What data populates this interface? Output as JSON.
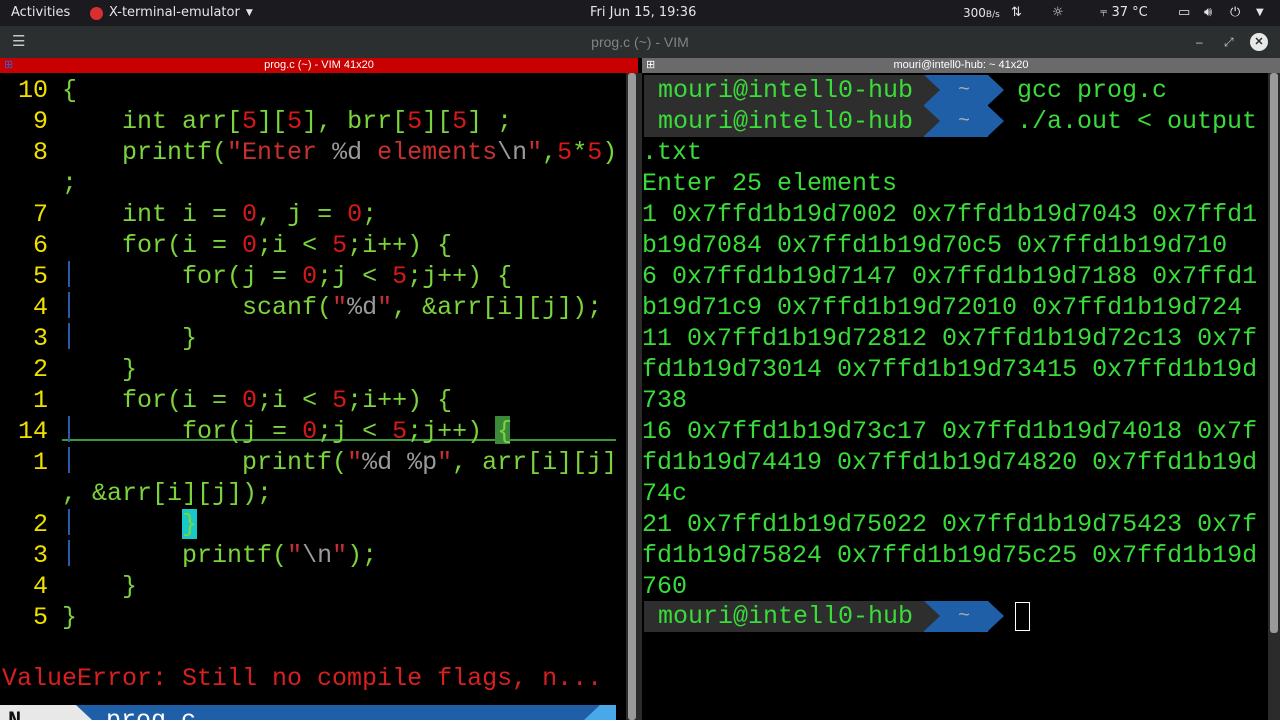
{
  "topbar": {
    "activities": "Activities",
    "app_menu": "X-terminal-emulator",
    "clock": "Fri Jun 15, 19:36",
    "net_speed": "300",
    "net_unit": "B/s",
    "temperature": "37 °C"
  },
  "window": {
    "title": "prog.c (~) - VIM"
  },
  "panes": {
    "left_title": "prog.c (~) - VIM 41x20",
    "right_title": "mouri@intell0-hub: ~ 41x20"
  },
  "vim": {
    "lines": [
      {
        "ln": "10",
        "code": "{"
      },
      {
        "ln": "9",
        "code": "    int arr[5][5], brr[5][5] ;"
      },
      {
        "ln": "8",
        "code": "    printf(\"Enter %d elements\\n\",5*5)"
      },
      {
        "ln": "",
        "code": ";"
      },
      {
        "ln": "7",
        "code": "    int i = 0, j = 0;"
      },
      {
        "ln": "6",
        "code": "    for(i = 0;i < 5;i++) {"
      },
      {
        "ln": "5",
        "code": "        for(j = 0;j < 5;j++) {"
      },
      {
        "ln": "4",
        "code": "            scanf(\"%d\", &arr[i][j]);"
      },
      {
        "ln": "3",
        "code": "        }"
      },
      {
        "ln": "2",
        "code": "    }"
      },
      {
        "ln": "1",
        "code": "    for(i = 0;i < 5;i++) {"
      },
      {
        "ln": "14",
        "code": "        for(j = 0;j < 5;j++) {"
      },
      {
        "ln": "1",
        "code": "            printf(\"%d %p\", arr[i][j]"
      },
      {
        "ln": "",
        "code": ", &arr[i][j]);"
      },
      {
        "ln": "2",
        "code": "        }"
      },
      {
        "ln": "3",
        "code": "        printf(\"\\n\");"
      },
      {
        "ln": "4",
        "code": "    }"
      },
      {
        "ln": "5",
        "code": "}"
      }
    ],
    "mode": "N...",
    "filename": "prog.c",
    "error": "ValueError: Still no compile flags, n..."
  },
  "terminal": {
    "host": "mouri@intell0-hub",
    "dir": "~",
    "cmd1": "gcc prog.c",
    "cmd2": "./a.out < output",
    "output": [
      ".txt",
      "Enter 25 elements",
      "1 0x7ffd1b19d7002 0x7ffd1b19d7043 0x7ffd1",
      "b19d7084 0x7ffd1b19d70c5 0x7ffd1b19d710",
      "6 0x7ffd1b19d7147 0x7ffd1b19d7188 0x7ffd1",
      "b19d71c9 0x7ffd1b19d72010 0x7ffd1b19d724",
      "11 0x7ffd1b19d72812 0x7ffd1b19d72c13 0x7f",
      "fd1b19d73014 0x7ffd1b19d73415 0x7ffd1b19d",
      "738",
      "16 0x7ffd1b19d73c17 0x7ffd1b19d74018 0x7f",
      "fd1b19d74419 0x7ffd1b19d74820 0x7ffd1b19d",
      "74c",
      "21 0x7ffd1b19d75022 0x7ffd1b19d75423 0x7f",
      "fd1b19d75824 0x7ffd1b19d75c25 0x7ffd1b19d",
      "760"
    ]
  }
}
